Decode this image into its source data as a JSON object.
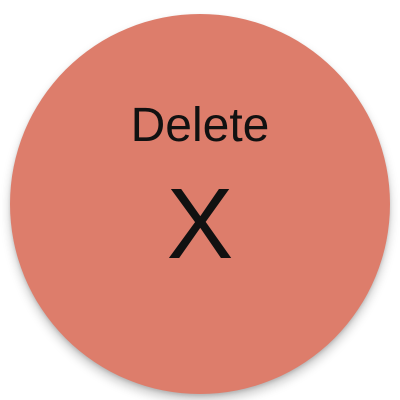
{
  "delete_button": {
    "label": "Delete",
    "glyph": "X",
    "icon": "close-icon",
    "fill_color": "#dd7d6b",
    "text_color": "#111111"
  }
}
